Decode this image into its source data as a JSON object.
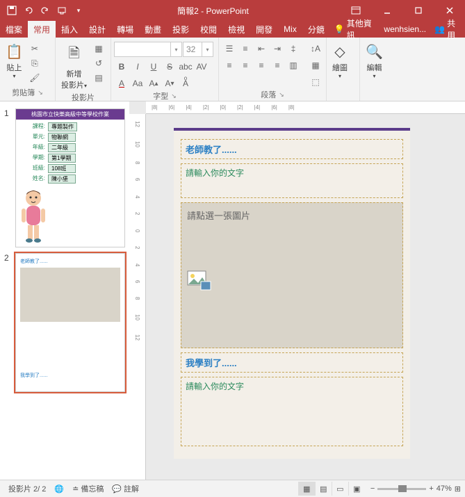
{
  "titlebar": {
    "title": "簡報2 - PowerPoint"
  },
  "menubar": {
    "file": "檔案",
    "home": "常用",
    "insert": "插入",
    "design": "設計",
    "transition": "轉場",
    "animation": "動畫",
    "slideshow": "投影",
    "review": "校閱",
    "view": "檢視",
    "developer": "開發",
    "mix": "Mix",
    "storyline": "分鏡",
    "tellme": "其他資訊",
    "user": "wenhsien...",
    "share": "共用"
  },
  "ribbon": {
    "clipboard": {
      "label": "剪貼簿",
      "paste": "貼上"
    },
    "slides": {
      "label": "投影片",
      "newslide": "新增",
      "newslide2": "投影片"
    },
    "font": {
      "label": "字型",
      "size": "32"
    },
    "paragraph": {
      "label": "段落"
    },
    "drawing": {
      "label": "繪圖"
    },
    "editing": {
      "label": "編輯"
    }
  },
  "slide1": {
    "header": "桃園市立快樂高級中等學校作業",
    "rows": [
      {
        "k": "課程:",
        "v": "專題製作"
      },
      {
        "k": "單元:",
        "v": "物聯網"
      },
      {
        "k": "年級:",
        "v": "二年級"
      },
      {
        "k": "學期:",
        "v": "第1學期"
      },
      {
        "k": "班級:",
        "v": "108班"
      },
      {
        "k": "姓名:",
        "v": "陳小堡"
      }
    ]
  },
  "slide2": {
    "teacher": "老師教了......",
    "learned": "我學到了......"
  },
  "editor": {
    "teacher_title": "老師教了......",
    "teacher_placeholder": "請輸入你的文字",
    "image_placeholder": "請點選一張圖片",
    "learned_title": "我學到了......",
    "learned_placeholder": "請輸入你的文字"
  },
  "statusbar": {
    "slide": "投影片 2/ 2",
    "lang": "",
    "notes": "備忘稿",
    "comments": "註解",
    "zoom": "47%"
  },
  "ruler_marks": [
    "8",
    "6",
    "4",
    "2",
    "0",
    "2",
    "4",
    "6",
    "8"
  ]
}
